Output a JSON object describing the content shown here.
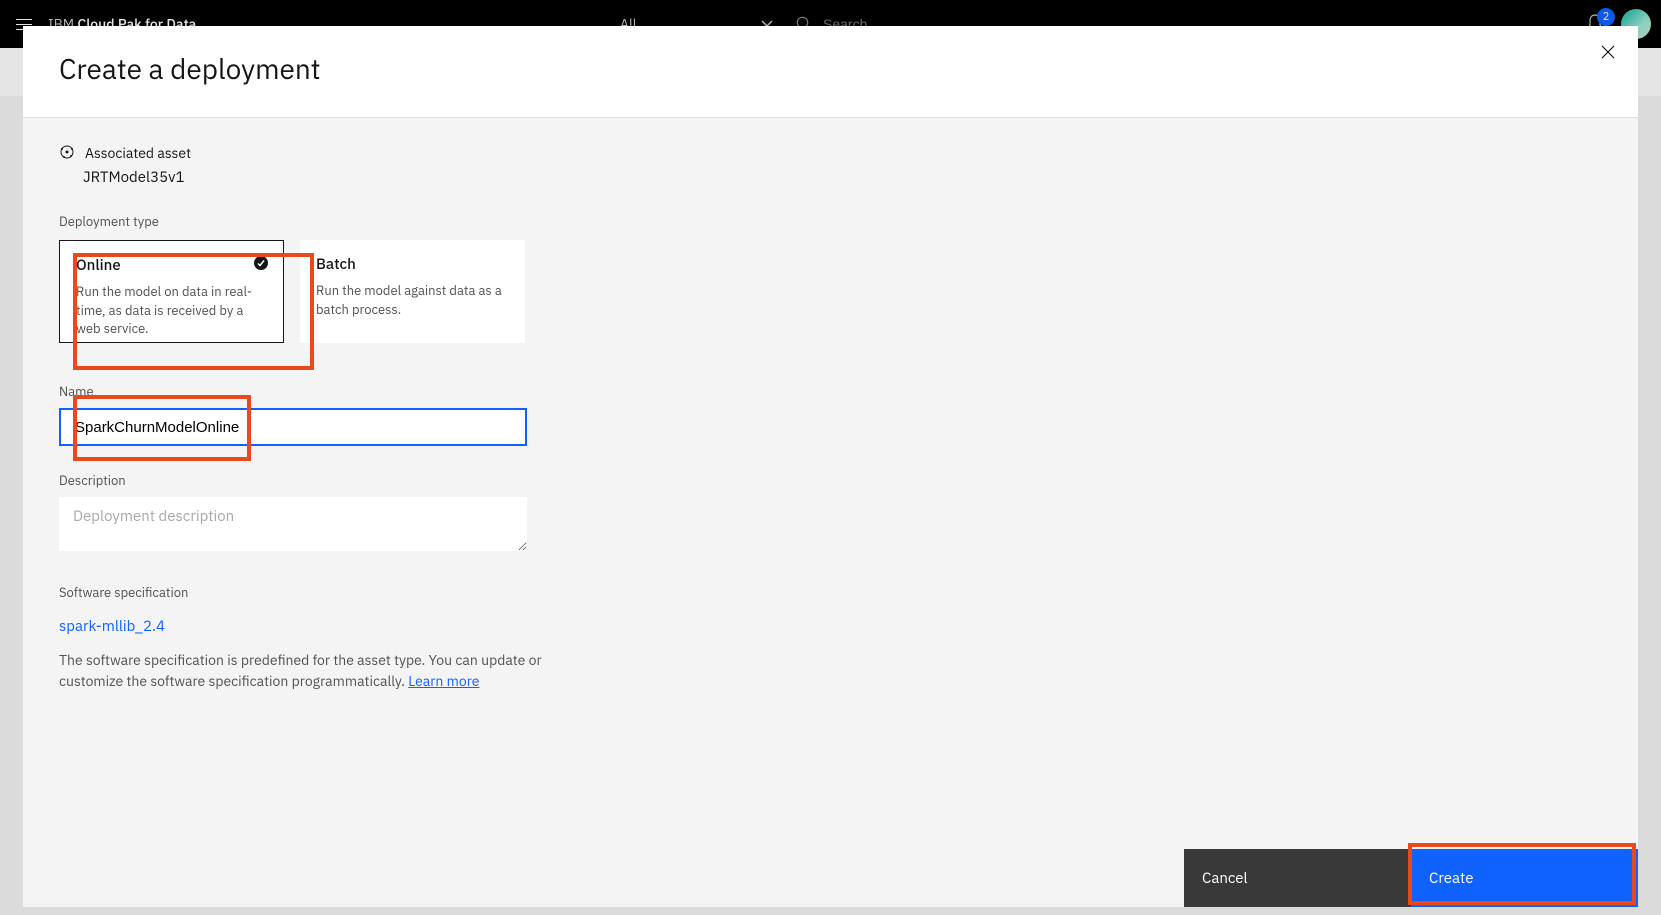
{
  "topbar": {
    "brand_prefix": "IBM ",
    "brand_bold": "Cloud Pak for Data",
    "all_label": "All",
    "search_placeholder": "Search",
    "notification_count": "2"
  },
  "modal": {
    "title": "Create a deployment",
    "associated_asset_label": "Associated asset",
    "associated_asset_value": "JRTModel35v1",
    "deployment_type_label": "Deployment type",
    "cards": {
      "online": {
        "title": "Online",
        "desc": "Run the model on data in real-time, as data is received by a web service."
      },
      "batch": {
        "title": "Batch",
        "desc": "Run the model against data as a batch process."
      }
    },
    "name_label": "Name",
    "name_value": "SparkChurnModelOnline",
    "description_label": "Description",
    "description_placeholder": "Deployment description",
    "swspec_label": "Software specification",
    "swspec_link": "spark-mllib_2.4",
    "swspec_text": "The software specification is predefined for the asset type. You can update or customize the software specification programmatically. ",
    "learn_more": "Learn more",
    "cancel": "Cancel",
    "create": "Create"
  }
}
